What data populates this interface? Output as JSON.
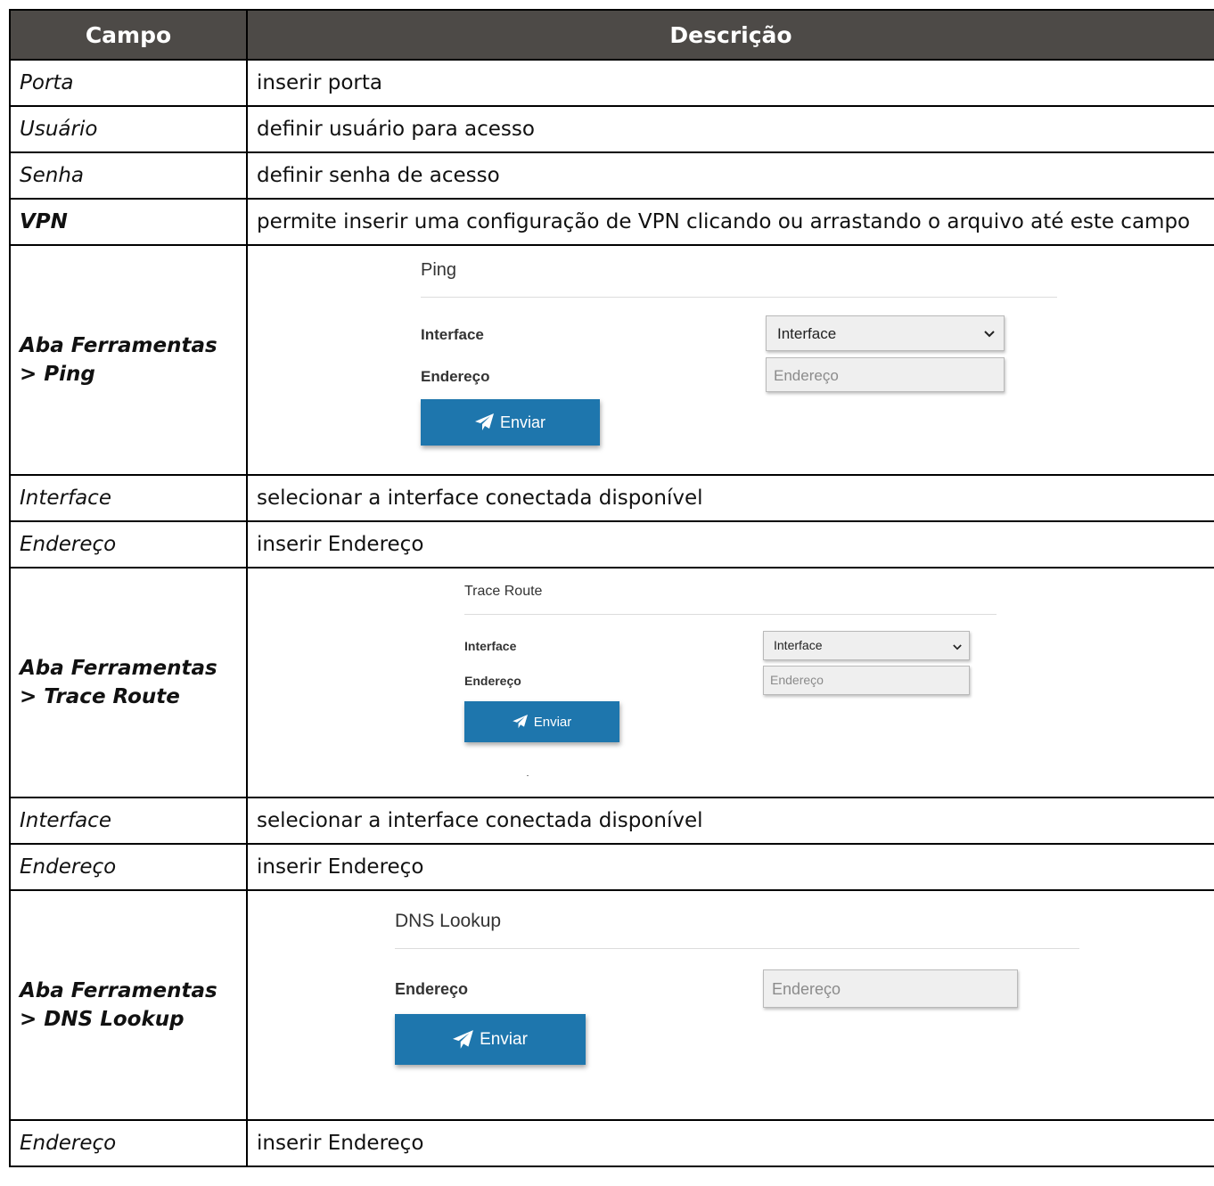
{
  "header": {
    "col1": "Campo",
    "col2": "Descrição"
  },
  "rows": [
    {
      "field": "Porta",
      "desc": "inserir porta"
    },
    {
      "field": "Usuário",
      "desc": "definir usuário para acesso"
    },
    {
      "field": "Senha",
      "desc": "definir senha de acesso"
    },
    {
      "field": "VPN",
      "desc": "permite inserir uma configuração de VPN clicando ou arrastando o arquivo até este campo"
    }
  ],
  "ping": {
    "field_line1": "Aba Ferramentas",
    "field_line2": "> Ping",
    "title": "Ping",
    "interface_label": "Interface",
    "interface_value": "Interface",
    "address_label": "Endereço",
    "address_placeholder": "Endereço",
    "button": "Enviar"
  },
  "ping_rows": [
    {
      "field": "Interface",
      "desc": "selecionar a interface conectada disponível"
    },
    {
      "field": "Endereço",
      "desc": "inserir Endereço"
    }
  ],
  "trace": {
    "field_line1": "Aba Ferramentas",
    "field_line2": "> Trace Route",
    "title": "Trace Route",
    "interface_label": "Interface",
    "interface_value": "Interface",
    "address_label": "Endereço",
    "address_placeholder": "Endereço",
    "button": "Enviar"
  },
  "trace_rows": [
    {
      "field": "Interface",
      "desc": "selecionar a interface conectada disponível"
    },
    {
      "field": "Endereço",
      "desc": "inserir Endereço"
    }
  ],
  "dns": {
    "field_line1": "Aba Ferramentas",
    "field_line2": "> DNS Lookup",
    "title": "DNS Lookup",
    "address_label": "Endereço",
    "address_placeholder": "Endereço",
    "button": "Enviar"
  },
  "dns_rows": [
    {
      "field": "Endereço",
      "desc": "inserir Endereço"
    }
  ],
  "icons": {
    "send": "paper-plane-icon",
    "dropdown": "chevron-down-icon"
  }
}
